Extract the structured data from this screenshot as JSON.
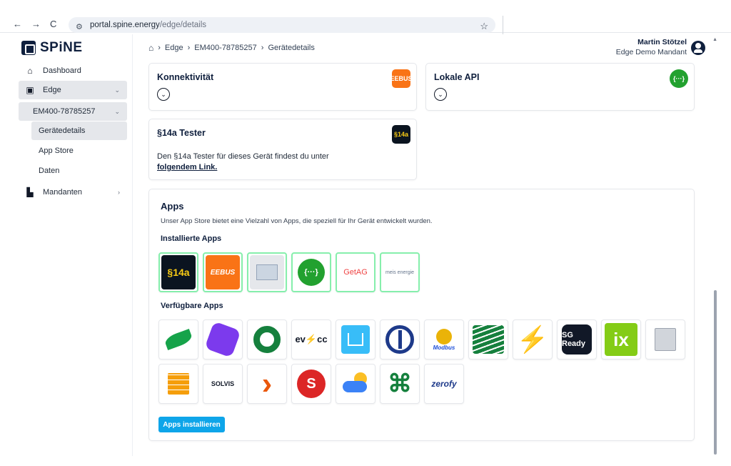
{
  "browser": {
    "back_icon": "←",
    "forward_icon": "→",
    "reload_icon": "C",
    "url_host": "portal.spine.energy",
    "url_path": "/edge/details",
    "star_icon": "☆"
  },
  "sidebar": {
    "logo_text": "SPiNE",
    "items": [
      {
        "label": "Dashboard"
      },
      {
        "label": "Edge"
      },
      {
        "label": "EM400-78785257"
      },
      {
        "label": "Gerätedetails"
      },
      {
        "label": "App Store"
      },
      {
        "label": "Daten"
      },
      {
        "label": "Mandanten"
      }
    ]
  },
  "header": {
    "breadcrumb": [
      "Edge",
      "EM400-78785257",
      "Gerätedetails"
    ],
    "user_name": "Martin Stötzel",
    "tenant": "Edge Demo Mandant"
  },
  "cards": {
    "konnektivitaet": {
      "title": "Konnektivität",
      "icon_text": "EEBUS"
    },
    "lokale_api": {
      "title": "Lokale API",
      "icon_text": "{···}"
    },
    "tester": {
      "title": "§14a Tester",
      "icon_text": "§14a",
      "text": "Den §14a Tester für dieses Gerät findest du unter",
      "link": "folgendem Link."
    }
  },
  "apps": {
    "title": "Apps",
    "description": "Unser App Store bietet eine Vielzahl von Apps, die speziell für Ihr Gerät entwickelt wurden.",
    "installed_title": "Installierte Apps",
    "available_title": "Verfügbare Apps",
    "install_button": "Apps installieren",
    "installed": [
      {
        "text": "§14a"
      },
      {
        "text": "EEBUS"
      },
      {
        "text": ""
      },
      {
        "text": "{···}"
      },
      {
        "text": "GetAG"
      },
      {
        "text": "meis energie"
      }
    ],
    "available": [
      {
        "text": ""
      },
      {
        "text": ""
      },
      {
        "text": ""
      },
      {
        "text": "ev⚡cc"
      },
      {
        "text": ""
      },
      {
        "text": ""
      },
      {
        "text": "Modbus"
      },
      {
        "text": ""
      },
      {
        "text": "⚡"
      },
      {
        "text": "SG Ready"
      },
      {
        "text": "ix"
      },
      {
        "text": ""
      },
      {
        "text": ""
      },
      {
        "text": "SOLVIS"
      },
      {
        "text": ""
      },
      {
        "text": "S"
      },
      {
        "text": ""
      },
      {
        "text": ""
      },
      {
        "text": "zerofy"
      }
    ]
  },
  "colors": {
    "brand": "#0f1f3d",
    "accent": "#0ea5e9",
    "installed_border": "#86efac"
  }
}
